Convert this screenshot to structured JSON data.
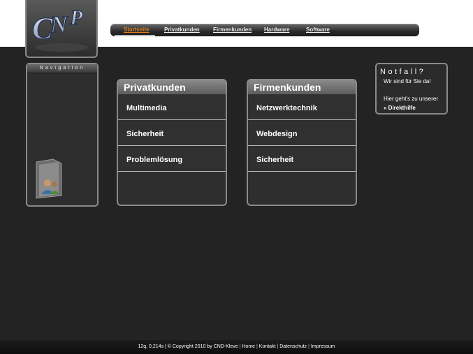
{
  "nav": {
    "items": [
      {
        "label": "Startseite",
        "active": true
      },
      {
        "label": "Privatkunden"
      },
      {
        "label": "Firmenkunden"
      },
      {
        "label": "Hardware"
      },
      {
        "label": "Software"
      }
    ],
    "active_color": "#e08020"
  },
  "sidebar": {
    "title": "Navigation",
    "icon": "folder-users-icon"
  },
  "logo": {
    "text": "CNP"
  },
  "panels": [
    {
      "title": "Privatkunden",
      "items": [
        "Multimedia",
        "Sicherheit",
        "Problemlösung"
      ]
    },
    {
      "title": "Firmenkunden",
      "items": [
        "Netzwerktechnik",
        "Webdesign",
        "Sicherheit"
      ]
    }
  ],
  "notfall": {
    "title": "Notfall?",
    "subtitle": "Wir sind für Sie da!",
    "text": "Hier geht's zu unserer",
    "link": "» Direkthilfe"
  },
  "footer": {
    "meta": "12q, 0,214s | © Copyright 2010 by CND-Kleve",
    "links": [
      "Home",
      "Kontakt",
      "Datenschutz",
      "Impressum"
    ]
  }
}
